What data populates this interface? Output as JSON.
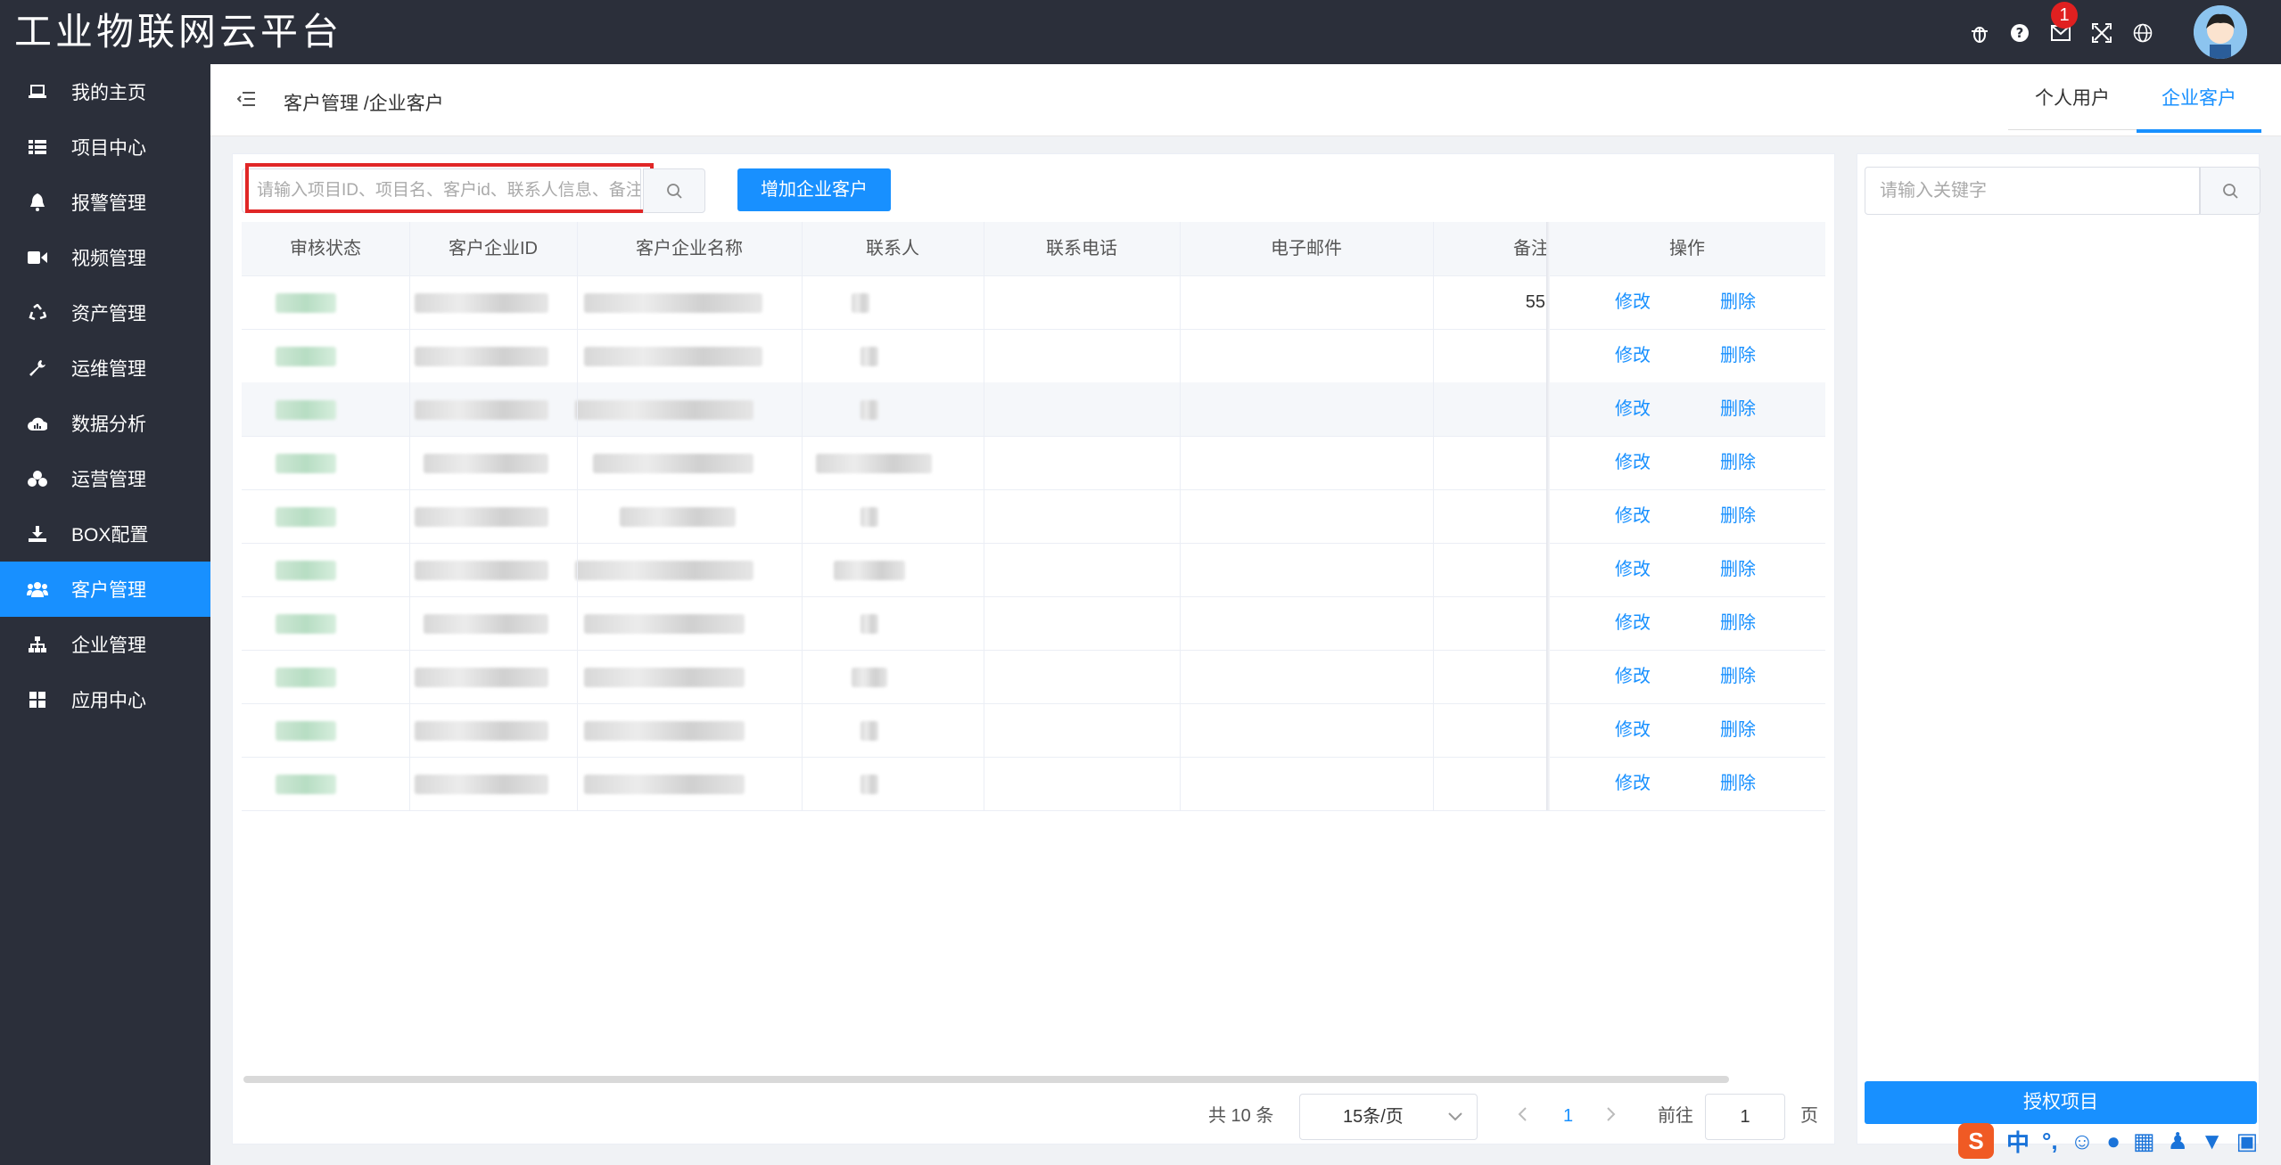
{
  "app": {
    "title": "工业物联网云平台",
    "notification_count": "1"
  },
  "sidebar": {
    "items": [
      {
        "label": "我的主页",
        "icon": "laptop-icon"
      },
      {
        "label": "项目中心",
        "icon": "list-icon"
      },
      {
        "label": "报警管理",
        "icon": "bell-icon"
      },
      {
        "label": "视频管理",
        "icon": "video-icon"
      },
      {
        "label": "资产管理",
        "icon": "recycle-icon"
      },
      {
        "label": "运维管理",
        "icon": "wrench-icon"
      },
      {
        "label": "数据分析",
        "icon": "cloud-chart-icon"
      },
      {
        "label": "运营管理",
        "icon": "cubes-icon"
      },
      {
        "label": "BOX配置",
        "icon": "download-icon"
      },
      {
        "label": "客户管理",
        "icon": "users-icon",
        "active": true
      },
      {
        "label": "企业管理",
        "icon": "sitemap-icon"
      },
      {
        "label": "应用中心",
        "icon": "grid-icon"
      }
    ]
  },
  "header": {
    "breadcrumb": "客户管理 /企业客户",
    "tabs": [
      {
        "label": "个人用户"
      },
      {
        "label": "企业客户",
        "active": true
      }
    ]
  },
  "toolbar": {
    "search_placeholder": "请输入项目ID、项目名、客户id、联系人信息、备注",
    "add_label": "增加企业客户"
  },
  "table": {
    "columns": [
      "审核状态",
      "客户企业ID",
      "客户企业名称",
      "联系人",
      "联系电话",
      "电子邮件",
      "备注",
      "操作"
    ],
    "rows": [
      {
        "remark": "55",
        "contact_hint": "苗"
      },
      {
        "remark": ""
      },
      {
        "remark": ""
      },
      {
        "remark": ""
      },
      {
        "remark": ""
      },
      {
        "remark": ""
      },
      {
        "remark": ""
      },
      {
        "remark": ""
      },
      {
        "remark": ""
      },
      {
        "remark": ""
      }
    ],
    "edit_label": "修改",
    "delete_label": "删除"
  },
  "pager": {
    "total": "共 10 条",
    "page_size": "15条/页",
    "current_page": "1",
    "goto_label": "前往",
    "goto_value": "1",
    "page_unit": "页"
  },
  "right_panel": {
    "keyword_placeholder": "请输入关键字",
    "authorize_label": "授权项目"
  },
  "ime": {
    "mode_label": "中"
  }
}
